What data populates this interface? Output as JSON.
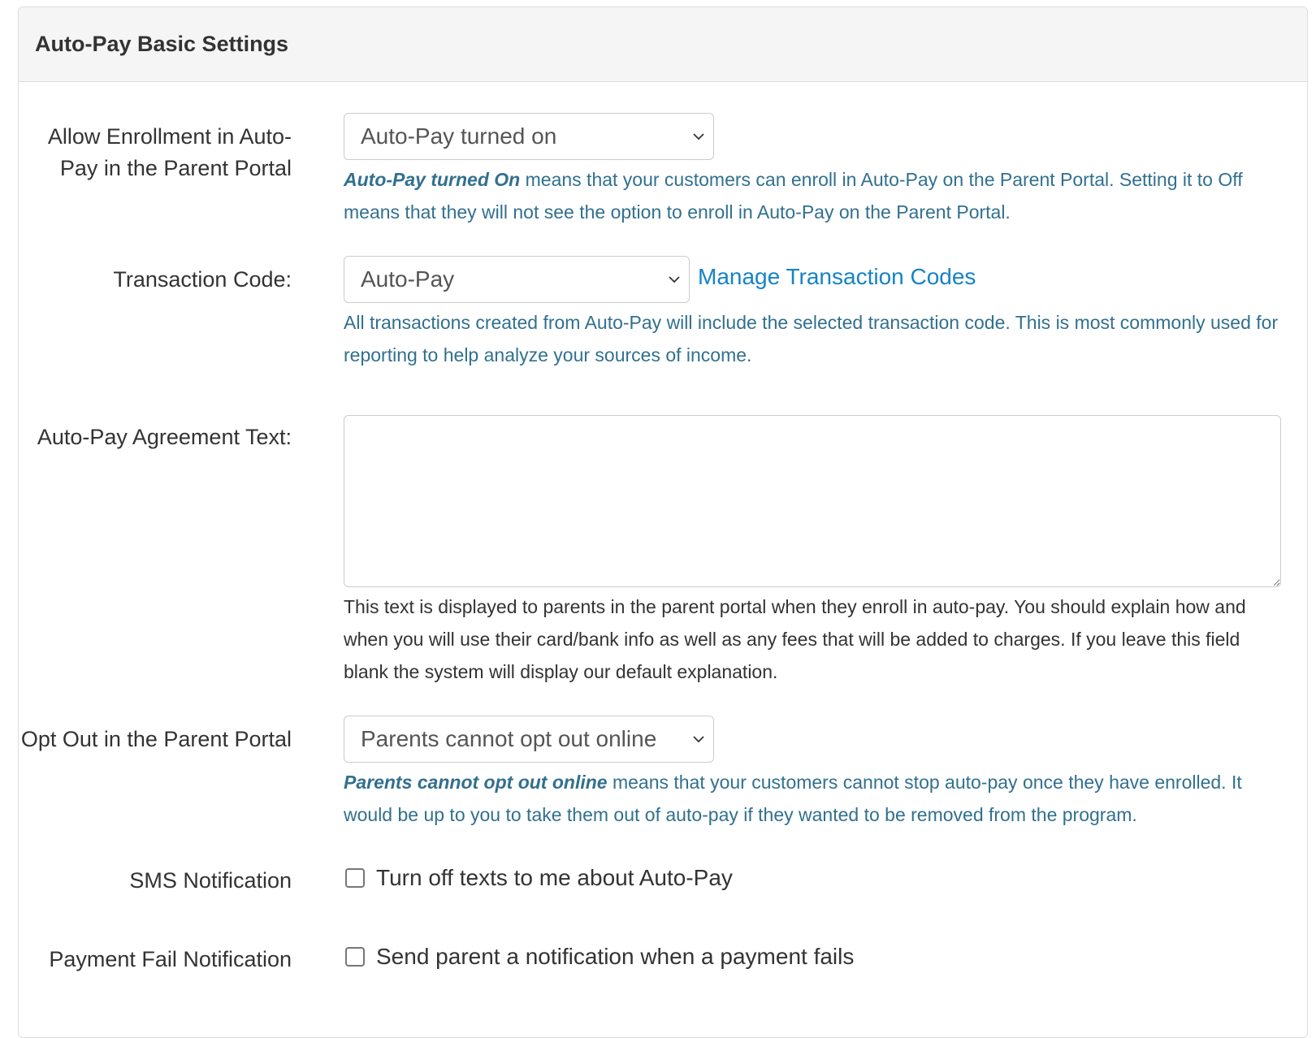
{
  "panel": {
    "title": "Auto-Pay Basic Settings"
  },
  "enrollment": {
    "label": "Allow Enrollment in Auto-Pay in the Parent Portal",
    "selected": "Auto-Pay turned on",
    "help_emphasis": "Auto-Pay turned On",
    "help_text": " means that your customers can enroll in Auto-Pay on the Parent Portal. Setting it to Off means that they will not see the option to enroll in Auto-Pay on the Parent Portal."
  },
  "transaction_code": {
    "label": "Transaction Code:",
    "selected": "Auto-Pay",
    "manage_link": "Manage Transaction Codes",
    "help_text": "All transactions created from Auto-Pay will include the selected transaction code. This is most commonly used for reporting to help analyze your sources of income."
  },
  "agreement": {
    "label": "Auto-Pay Agreement Text:",
    "value": "",
    "help_text": "This text is displayed to parents in the parent portal when they enroll in auto-pay. You should explain how and when you will use their card/bank info as well as any fees that will be added to charges. If you leave this field blank the system will display our default explanation."
  },
  "opt_out": {
    "label": "Opt Out in the Parent Portal",
    "selected": "Parents cannot opt out online",
    "help_emphasis": "Parents cannot opt out online",
    "help_text": " means that your customers cannot stop auto-pay once they have enrolled. It would be up to you to take them out of auto-pay if they wanted to be removed from the program."
  },
  "sms": {
    "label": "SMS Notification",
    "checkbox_label": "Turn off texts to me about Auto-Pay",
    "checked": false
  },
  "payment_fail": {
    "label": "Payment Fail Notification",
    "checkbox_label": "Send parent a notification when a payment fails",
    "checked": false
  }
}
